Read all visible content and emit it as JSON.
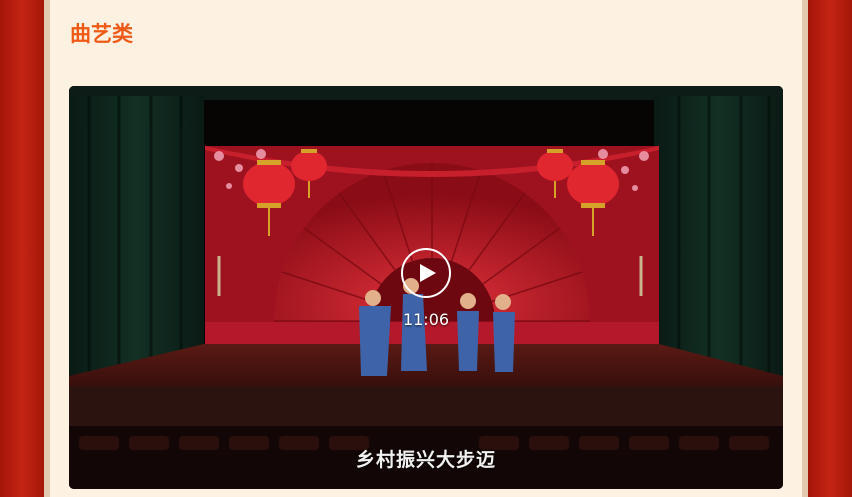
{
  "section": {
    "title": "曲艺类"
  },
  "video": {
    "duration": "11:06",
    "subtitle": "乡村振兴大步迈",
    "play_icon": "play-icon"
  },
  "colors": {
    "background_red": "#b81d0f",
    "panel_cream": "#fdf1e2",
    "title_orange": "#ef5a16",
    "stage_red": "#c0182a",
    "performer_blue": "#3e63a8"
  }
}
